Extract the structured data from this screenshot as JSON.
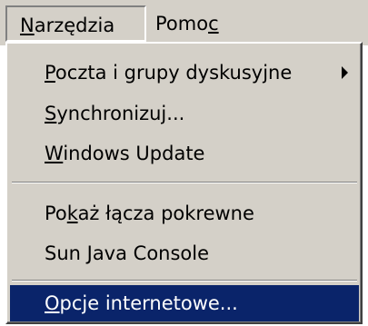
{
  "menubar": {
    "menus": [
      {
        "pre": "",
        "mn": "N",
        "post": "arzędzia"
      },
      {
        "pre": "Pomo",
        "mn": "c",
        "post": ""
      }
    ]
  },
  "dropdown": {
    "items": [
      {
        "pre": "",
        "mn": "P",
        "post": "oczta i grupy dyskusyjne",
        "submenu": true
      },
      {
        "pre": "",
        "mn": "S",
        "post": "ynchronizuj..."
      },
      {
        "pre": "",
        "mn": "W",
        "post": "indows Update"
      },
      {
        "pre": "Po",
        "mn": "k",
        "post": "aż łącza pokrewne"
      },
      {
        "pre": "Sun Java Console",
        "mn": "",
        "post": ""
      },
      {
        "pre": "",
        "mn": "O",
        "post": "pcje internetowe..."
      }
    ],
    "submenu_icon": "submenu-arrow-icon",
    "selected_index": 5,
    "colors": {
      "menu_bg": "#d4d0c8",
      "highlight": "#0a246a",
      "highlight_text": "#ffffff"
    }
  }
}
